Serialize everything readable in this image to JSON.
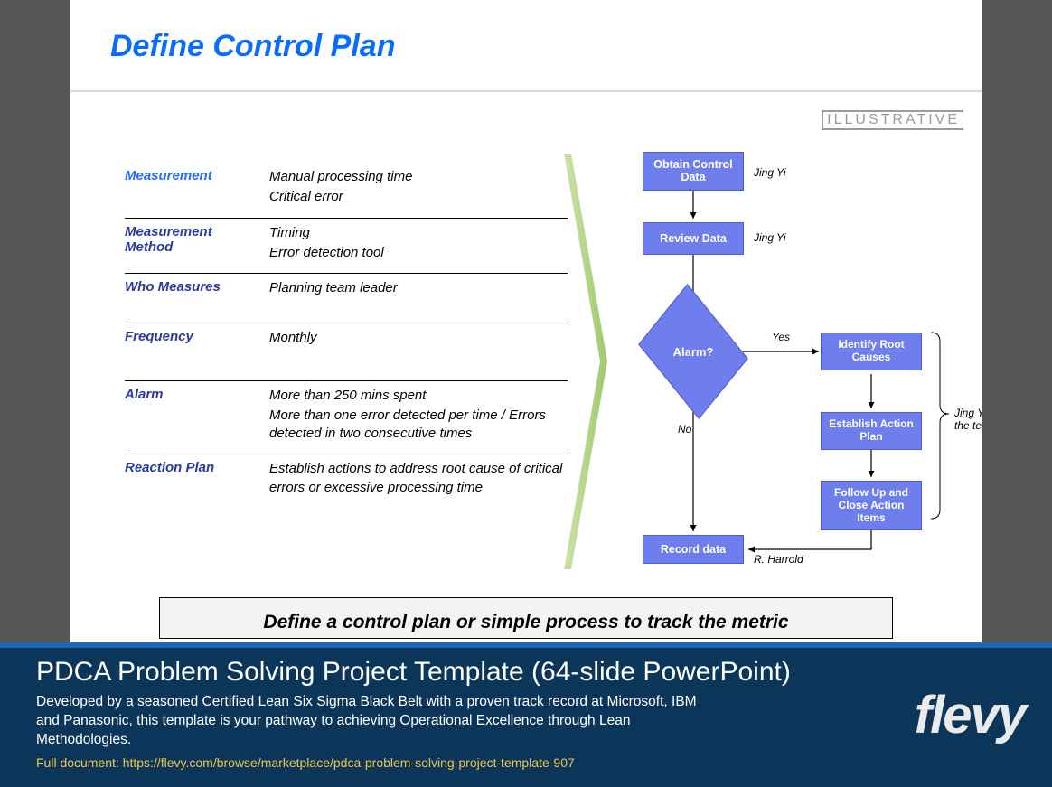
{
  "slide": {
    "title": "Define Control Plan",
    "badge": "ILLUSTRATIVE",
    "rows": [
      {
        "label": "Measurement",
        "lines": [
          "Manual processing time",
          "Critical error"
        ]
      },
      {
        "label": "Measurement Method",
        "lines": [
          "Timing",
          "Error detection tool"
        ]
      },
      {
        "label": "Who Measures",
        "lines": [
          "Planning team leader"
        ]
      },
      {
        "label": "Frequency",
        "lines": [
          "Monthly"
        ]
      },
      {
        "label": "Alarm",
        "lines": [
          "More than 250 mins spent",
          "More than one error detected per time / Errors detected in two consecutive times"
        ]
      },
      {
        "label": "Reaction Plan",
        "lines": [
          "Establish actions to address root cause of critical errors or excessive processing time"
        ]
      }
    ],
    "footer_text": "Define a control plan or simple process to track the metric"
  },
  "flow": {
    "nodes": {
      "obtain": "Obtain Control Data",
      "review": "Review Data",
      "alarm": "Alarm?",
      "identify": "Identify Root Causes",
      "establish": "Establish Action Plan",
      "follow": "Follow Up and Close Action Items",
      "record": "Record data"
    },
    "edge_labels": {
      "yes": "Yes",
      "no": "No"
    },
    "owners": {
      "obtain": "Jing Yi",
      "review": "Jing Yi",
      "group": "Jing Yi and the the team",
      "record": "R. Harrold"
    }
  },
  "banner": {
    "title_bold": "PDCA Problem Solving Project Template",
    "title_paren": "(64-slide PowerPoint)",
    "description": "Developed by a seasoned Certified Lean Six Sigma Black Belt with a proven track record at Microsoft, IBM and Panasonic, this template is your pathway to achieving Operational Excellence through Lean Methodologies.",
    "link_label": "Full document: https://flevy.com/browse/marketplace/pdca-problem-solving-project-template-907",
    "logo": "flevy"
  }
}
